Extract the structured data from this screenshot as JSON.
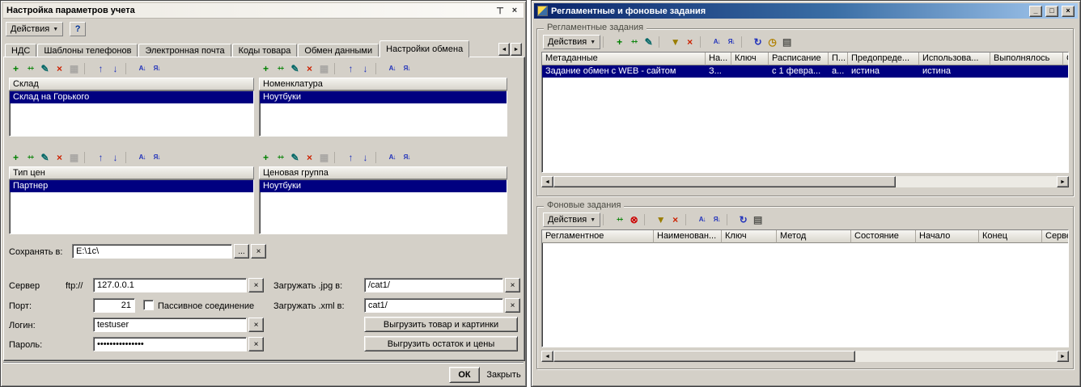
{
  "glyphs": {
    "dropdown": "▼",
    "pin": "⊤",
    "close": "×",
    "minimize": "_",
    "maximize": "□",
    "help": "?",
    "left_arrow": "◄",
    "right_arrow": "►",
    "browse": "...",
    "clear": "×"
  },
  "left_window": {
    "title": "Настройка параметров учета",
    "menu": {
      "actions": "Действия"
    },
    "tabs": [
      "НДС",
      "Шаблоны телефонов",
      "Электронная почта",
      "Коды товара",
      "Обмен данными",
      "Настройки обмена"
    ],
    "active_tab": 5,
    "lists": {
      "warehouse": {
        "header": "Склад",
        "items": [
          "Склад на Горького"
        ],
        "selected": 0
      },
      "nomenclature": {
        "header": "Номенклатура",
        "items": [
          "Ноутбуки"
        ],
        "selected": 0
      },
      "price_type": {
        "header": "Тип цен",
        "items": [
          "Партнер"
        ],
        "selected": 0
      },
      "price_group": {
        "header": "Ценовая группа",
        "items": [
          "Ноутбуки"
        ],
        "selected": 0
      }
    },
    "fields": {
      "save_to": {
        "label": "Сохранять в:",
        "value": "E:\\1c\\"
      },
      "server": {
        "label": "Сервер",
        "prefix": "ftp://",
        "value": "127.0.0.1"
      },
      "port": {
        "label": "Порт:",
        "value": "21"
      },
      "passive": {
        "label": "Пассивное соединение",
        "checked": false
      },
      "login": {
        "label": "Логин:",
        "value": "testuser"
      },
      "password": {
        "label": "Пароль:",
        "value": "•••••••••••••••"
      },
      "jpg": {
        "label": "Загружать .jpg в:",
        "value": "/cat1/"
      },
      "xml": {
        "label": "Загружать .xml в:",
        "value": "cat1/"
      }
    },
    "buttons": {
      "export_goods": "Выгрузить товар и картинки",
      "export_prices": "Выгрузить остаток и цены",
      "ok": "ОК",
      "close": "Закрыть"
    }
  },
  "right_window": {
    "title": "Регламентные и фоновые задания",
    "scheduled": {
      "title": "Регламентные задания",
      "actions": "Действия",
      "table": {
        "columns": [
          "Метаданные",
          "На...",
          "Ключ",
          "Расписание",
          "П...",
          "Предопреде...",
          "Использова...",
          "Выполнялось",
          "Состоя..."
        ],
        "widths": [
          202,
          32,
          46,
          74,
          24,
          88,
          88,
          90,
          80
        ],
        "rows": [
          [
            "Задание обмен с WEB - сайтом",
            "З...",
            "",
            "с 1 февра...",
            "а...",
            "истина",
            "истина",
            "",
            ""
          ]
        ],
        "selected_row": 0
      }
    },
    "background": {
      "title": "Фоновые задания",
      "actions": "Действия",
      "table": {
        "columns": [
          "Регламентное",
          "Наименован...",
          "Ключ",
          "Метод",
          "Состояние",
          "Начало",
          "Конец",
          "Сервер"
        ],
        "widths": [
          138,
          84,
          68,
          92,
          80,
          78,
          78,
          80
        ],
        "rows": []
      }
    }
  },
  "toolbars": {
    "list": [
      {
        "name": "add-icon",
        "glyph": "+",
        "color": "#008000"
      },
      {
        "name": "add-copy-icon",
        "glyph": "++",
        "color": "#008000"
      },
      {
        "name": "edit-icon",
        "glyph": "✎",
        "color": "#006666"
      },
      {
        "name": "delete-icon",
        "glyph": "×",
        "color": "#cc2200"
      },
      {
        "name": "save-order-icon",
        "glyph": "▦",
        "color": "#888880",
        "disabled": true
      },
      {
        "gap": true
      },
      {
        "name": "move-up-icon",
        "glyph": "↑",
        "color": "#2233bb"
      },
      {
        "name": "move-down-icon",
        "glyph": "↓",
        "color": "#2233bb"
      },
      {
        "gap": true
      },
      {
        "name": "sort-asc-icon",
        "glyph": "А↓",
        "color": "#2233bb"
      },
      {
        "name": "sort-desc-icon",
        "glyph": "Я↓",
        "color": "#2233bb"
      }
    ],
    "scheduled": [
      {
        "name": "add-icon",
        "glyph": "+",
        "color": "#008000"
      },
      {
        "name": "copy-icon",
        "glyph": "++",
        "color": "#008000"
      },
      {
        "name": "edit-icon",
        "glyph": "✎",
        "color": "#006666"
      },
      {
        "gap": true
      },
      {
        "name": "filter-icon",
        "glyph": "▼",
        "color": "#9a7d00"
      },
      {
        "name": "clear-filter-icon",
        "glyph": "×",
        "color": "#cc2200"
      },
      {
        "gap": true
      },
      {
        "name": "sort-asc-icon",
        "glyph": "А↓",
        "color": "#2233bb"
      },
      {
        "name": "sort-desc-icon",
        "glyph": "Я↓",
        "color": "#2233bb"
      },
      {
        "gap": true
      },
      {
        "name": "refresh-icon",
        "glyph": "↻",
        "color": "#2233bb"
      },
      {
        "name": "schedule-icon",
        "glyph": "◷",
        "color": "#b08000"
      },
      {
        "name": "settings-icon",
        "glyph": "▤",
        "color": "#555550"
      }
    ],
    "background": [
      {
        "name": "copy-icon",
        "glyph": "++",
        "color": "#008000"
      },
      {
        "name": "cancel-job-icon",
        "glyph": "⊗",
        "color": "#cc0000"
      },
      {
        "gap": true
      },
      {
        "name": "filter-icon",
        "glyph": "▼",
        "color": "#9a7d00"
      },
      {
        "name": "clear-filter-icon",
        "glyph": "×",
        "color": "#cc2200"
      },
      {
        "gap": true
      },
      {
        "name": "sort-asc-icon",
        "glyph": "А↓",
        "color": "#2233bb"
      },
      {
        "name": "sort-desc-icon",
        "glyph": "Я↓",
        "color": "#2233bb"
      },
      {
        "gap": true
      },
      {
        "name": "refresh-icon",
        "glyph": "↻",
        "color": "#2233bb"
      },
      {
        "name": "settings-icon",
        "glyph": "▤",
        "color": "#555550"
      }
    ]
  }
}
